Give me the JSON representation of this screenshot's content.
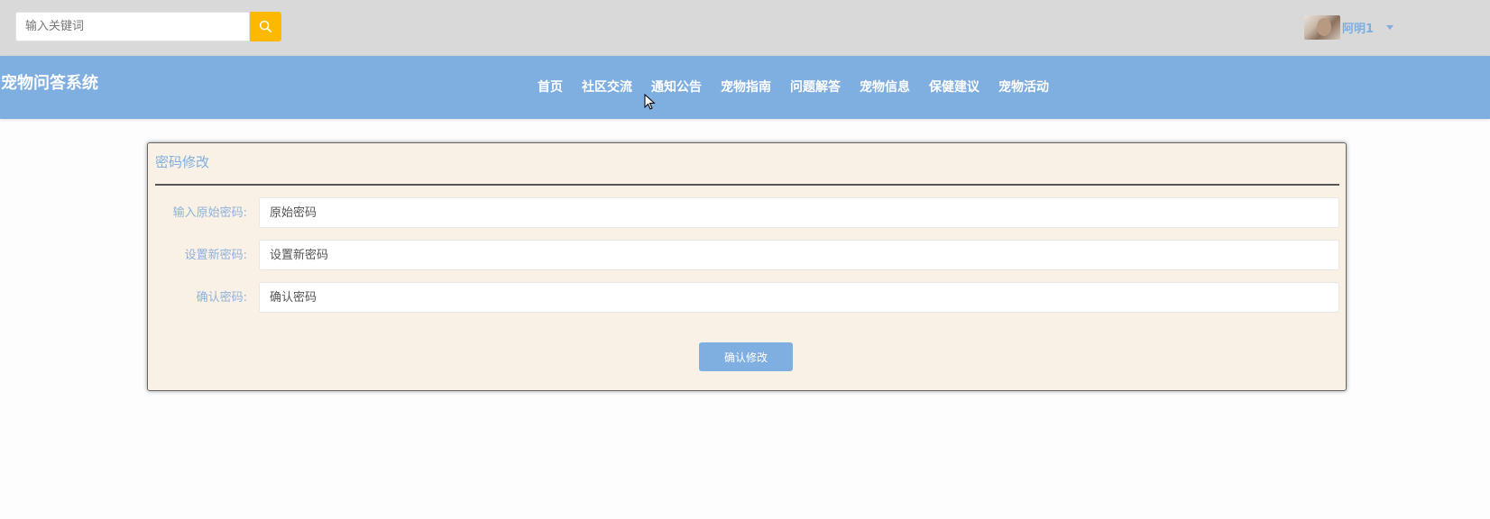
{
  "header": {
    "search_placeholder": "输入关键词",
    "search_icon": "search-icon",
    "accent_color": "#ffb800",
    "username": "阿明1",
    "dropdown_icon": "caret-down-icon"
  },
  "navbar": {
    "site_title": "宠物问答系统",
    "background_color": "#7faee0",
    "items": [
      {
        "label": "首页"
      },
      {
        "label": "社区交流"
      },
      {
        "label": "通知公告"
      },
      {
        "label": "宠物指南"
      },
      {
        "label": "问题解答"
      },
      {
        "label": "宠物信息"
      },
      {
        "label": "保健建议"
      },
      {
        "label": "宠物活动"
      }
    ]
  },
  "form": {
    "title": "密码修改",
    "panel_color": "#f9f1e5",
    "fields": [
      {
        "label": "输入原始密码:",
        "placeholder": "原始密码"
      },
      {
        "label": "设置新密码:",
        "placeholder": "设置新密码"
      },
      {
        "label": "确认密码:",
        "placeholder": "确认密码"
      }
    ],
    "submit_label": "确认修改"
  }
}
